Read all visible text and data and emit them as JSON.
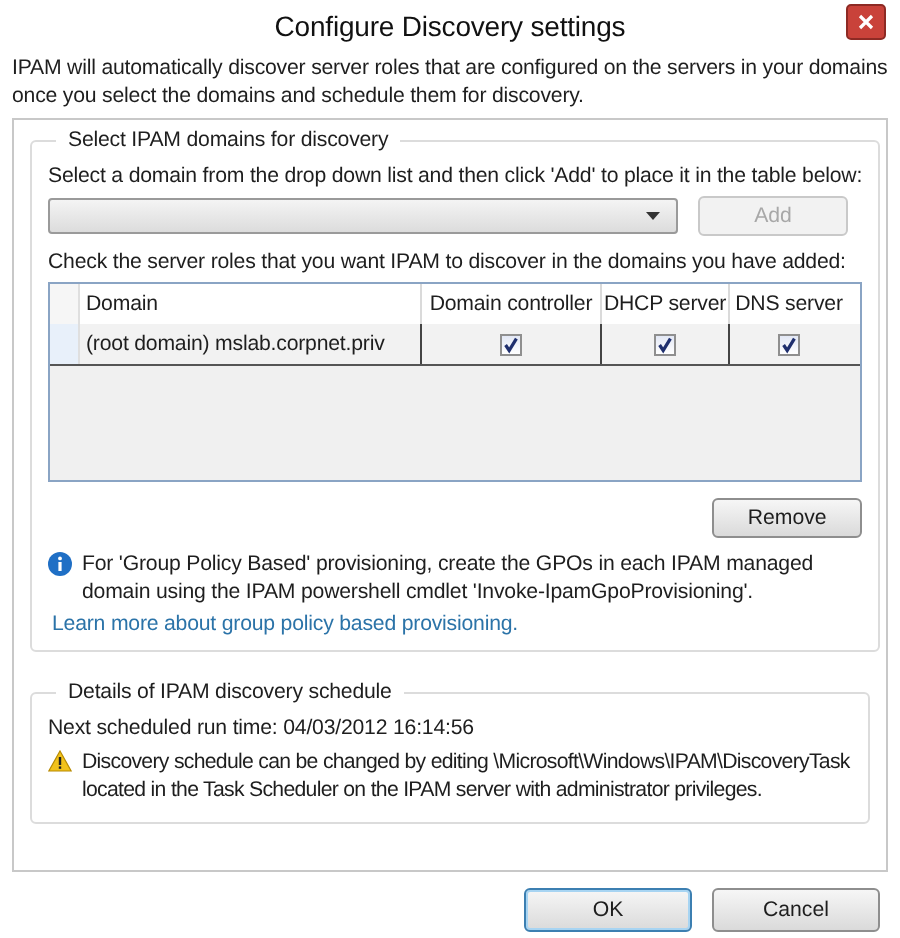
{
  "window": {
    "title": "Configure Discovery settings"
  },
  "intro": "IPAM will automatically discover server roles that are configured on the servers in your domains once you select the domains and schedule them for discovery.",
  "domains_group": {
    "legend": "Select IPAM domains for discovery",
    "instruction": "Select a domain from the drop down list and then click 'Add' to place it in the table below:",
    "add_button": {
      "label": "Add",
      "disabled": true
    },
    "roles_instruction": "Check the server roles that you want IPAM to discover in the domains you have added:",
    "table": {
      "columns": [
        "Domain",
        "Domain controller",
        "DHCP server",
        "DNS server"
      ],
      "rows": [
        {
          "domain": "(root domain) mslab.corpnet.priv",
          "roles": [
            true,
            true,
            true
          ]
        }
      ]
    },
    "remove_button": {
      "label": "Remove",
      "disabled": false
    },
    "info": "For 'Group Policy Based' provisioning, create the GPOs in each IPAM managed domain using the IPAM powershell cmdlet 'Invoke-IpamGpoProvisioning'.",
    "link": "Learn more about group policy based provisioning."
  },
  "schedule_group": {
    "legend": "Details of IPAM discovery schedule",
    "next_run": "Next scheduled run time: 04/03/2012 16:14:56",
    "warning": "Discovery schedule can be changed by editing \\Microsoft\\Windows\\IPAM\\DiscoveryTask located in the Task Scheduler on the IPAM server with administrator privileges."
  },
  "buttons": [
    {
      "label": "OK",
      "default": true
    },
    {
      "label": "Cancel",
      "default": false
    }
  ]
}
